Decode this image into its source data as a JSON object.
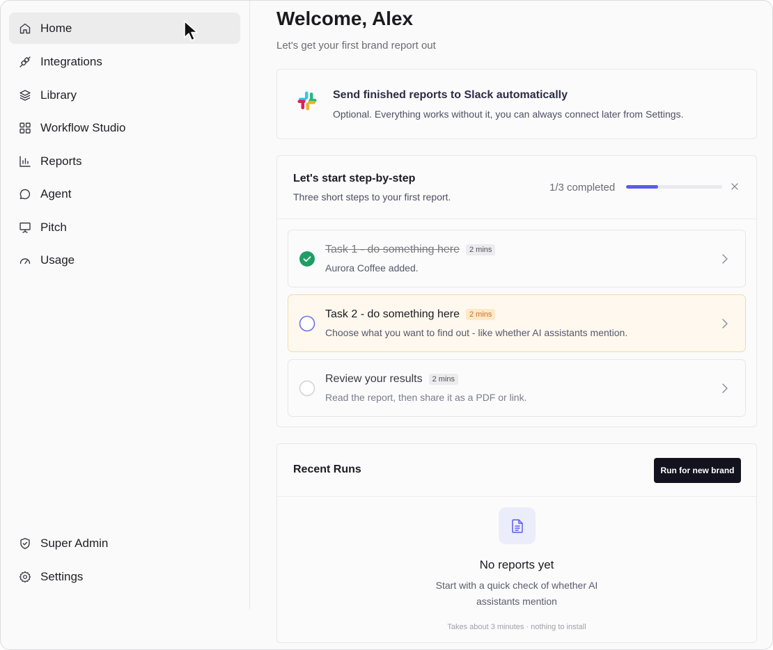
{
  "sidebar": {
    "items": [
      {
        "label": "Home",
        "icon": "home-icon",
        "active": true
      },
      {
        "label": "Integrations",
        "icon": "plug-icon"
      },
      {
        "label": "Library",
        "icon": "layers-icon"
      },
      {
        "label": "Workflow Studio",
        "icon": "grid-icon"
      },
      {
        "label": "Reports",
        "icon": "bar-chart-icon"
      },
      {
        "label": "Agent",
        "icon": "chat-bubble-icon"
      },
      {
        "label": "Pitch",
        "icon": "presentation-icon"
      },
      {
        "label": "Usage",
        "icon": "gauge-icon"
      }
    ],
    "bottom_items": [
      {
        "label": "Super Admin",
        "icon": "shield-icon"
      },
      {
        "label": "Settings",
        "icon": "gear-icon"
      }
    ]
  },
  "header": {
    "title": "Welcome, Alex",
    "subtitle": "Let's get your first brand report out"
  },
  "slack": {
    "title": "Send finished reports to Slack automatically",
    "description": "Optional. Everything works without it, you can always connect later from Settings."
  },
  "steps": {
    "title": "Let's start step-by-step",
    "subtitle": "Three short steps to your first report.",
    "progress_label": "1/3 completed",
    "progress_fraction": 0.33,
    "accent": "#5a5ce8",
    "tasks": [
      {
        "title": "Task 1 - do something here",
        "duration": "2 mins",
        "description": "Aurora Coffee added.",
        "status": "done"
      },
      {
        "title": "Task 2 - do something here",
        "duration": "2 mins",
        "description": "Choose what you want to find out - like whether AI assistants mention.",
        "status": "current"
      },
      {
        "title": "Review your results",
        "duration": "2 mins",
        "description": "Read the report, then share it as a PDF or link.",
        "status": "todo"
      }
    ]
  },
  "runs": {
    "title": "Recent Runs",
    "button_label": "Run for new brand",
    "empty_title": "No reports yet",
    "empty_description": "Start with a quick check of whether AI assistants mention",
    "empty_note": "Takes about 3 minutes · nothing to install"
  }
}
